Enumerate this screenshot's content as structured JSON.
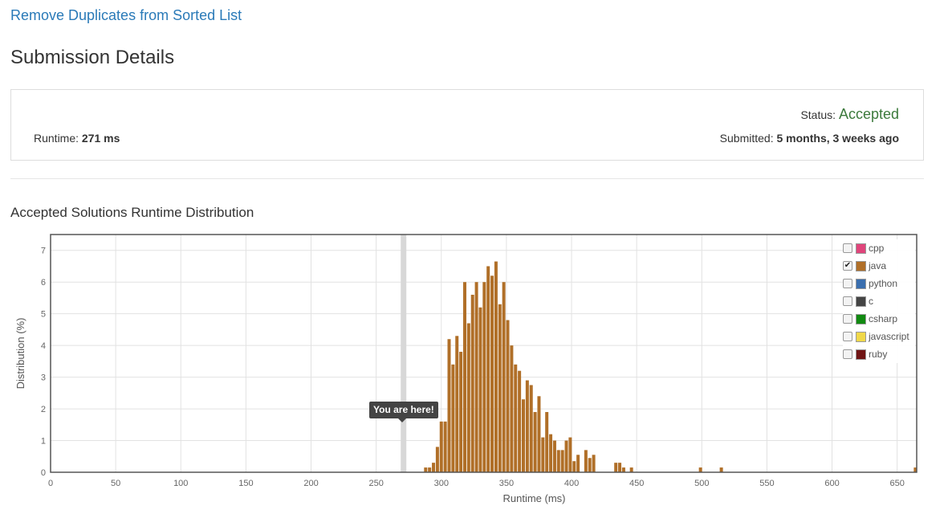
{
  "problem": {
    "title": "Remove Duplicates from Sorted List"
  },
  "page": {
    "title": "Submission Details"
  },
  "details": {
    "status_label": "Status:",
    "status_value": "Accepted",
    "runtime_label": "Runtime:",
    "runtime_value": "271 ms",
    "submitted_label": "Submitted:",
    "submitted_value": "5 months, 3 weeks ago"
  },
  "section": {
    "title": "Accepted Solutions Runtime Distribution"
  },
  "colors": {
    "link": "#2a7ab8",
    "accepted": "#3c7a3c",
    "bar": "#b06f28",
    "marker": "#d8d8d8"
  },
  "legend": [
    {
      "label": "cpp",
      "color": "#e0457b",
      "checked": false
    },
    {
      "label": "java",
      "color": "#b06f28",
      "checked": true
    },
    {
      "label": "python",
      "color": "#3b6faf",
      "checked": false
    },
    {
      "label": "c",
      "color": "#444444",
      "checked": false
    },
    {
      "label": "csharp",
      "color": "#118a11",
      "checked": false
    },
    {
      "label": "javascript",
      "color": "#f0d84a",
      "checked": false
    },
    {
      "label": "ruby",
      "color": "#701515",
      "checked": false
    }
  ],
  "tooltip": {
    "text": "You are here!"
  },
  "chart_data": {
    "type": "bar",
    "xlabel": "Runtime (ms)",
    "ylabel": "Distribution (%)",
    "xlim": [
      0,
      665
    ],
    "ylim": [
      0,
      7.5
    ],
    "xticks": [
      0,
      50,
      100,
      150,
      200,
      250,
      300,
      350,
      400,
      450,
      500,
      550,
      600,
      650
    ],
    "yticks": [
      0,
      1,
      2,
      3,
      4,
      5,
      6,
      7
    ],
    "grid": true,
    "legend_position": "top-right",
    "marker_x": 271,
    "series": [
      {
        "name": "java",
        "points": [
          [
            288,
            0.15
          ],
          [
            291,
            0.15
          ],
          [
            294,
            0.3
          ],
          [
            297,
            0.8
          ],
          [
            300,
            1.6
          ],
          [
            303,
            1.6
          ],
          [
            306,
            4.2
          ],
          [
            309,
            3.4
          ],
          [
            312,
            4.3
          ],
          [
            315,
            3.8
          ],
          [
            318,
            6.0
          ],
          [
            321,
            4.7
          ],
          [
            324,
            5.6
          ],
          [
            327,
            6.0
          ],
          [
            330,
            5.2
          ],
          [
            333,
            6.0
          ],
          [
            336,
            6.5
          ],
          [
            339,
            6.2
          ],
          [
            342,
            6.65
          ],
          [
            345,
            5.3
          ],
          [
            348,
            6.0
          ],
          [
            351,
            4.8
          ],
          [
            354,
            4.0
          ],
          [
            357,
            3.4
          ],
          [
            360,
            3.2
          ],
          [
            363,
            2.3
          ],
          [
            366,
            2.9
          ],
          [
            369,
            2.75
          ],
          [
            372,
            1.9
          ],
          [
            375,
            2.4
          ],
          [
            378,
            1.1
          ],
          [
            381,
            1.9
          ],
          [
            384,
            1.2
          ],
          [
            387,
            1.0
          ],
          [
            390,
            0.7
          ],
          [
            393,
            0.7
          ],
          [
            396,
            1.0
          ],
          [
            399,
            1.1
          ],
          [
            402,
            0.35
          ],
          [
            405,
            0.55
          ],
          [
            411,
            0.7
          ],
          [
            414,
            0.45
          ],
          [
            417,
            0.55
          ],
          [
            434,
            0.3
          ],
          [
            437,
            0.3
          ],
          [
            440,
            0.15
          ],
          [
            446,
            0.15
          ],
          [
            499,
            0.15
          ],
          [
            515,
            0.15
          ],
          [
            664,
            0.15
          ]
        ]
      }
    ]
  }
}
